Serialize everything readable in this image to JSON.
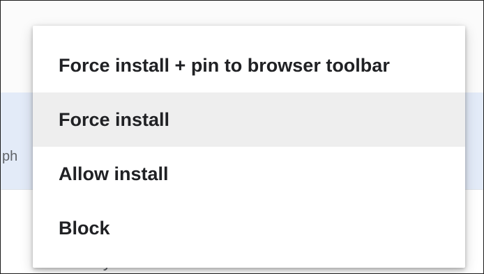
{
  "background": {
    "left_partial_text": "ph",
    "bottom_partial_text": "Locally added"
  },
  "menu": {
    "items": [
      {
        "label": "Force install + pin to browser toolbar",
        "highlighted": false
      },
      {
        "label": "Force install",
        "highlighted": true
      },
      {
        "label": "Allow install",
        "highlighted": false
      },
      {
        "label": "Block",
        "highlighted": false
      }
    ]
  }
}
